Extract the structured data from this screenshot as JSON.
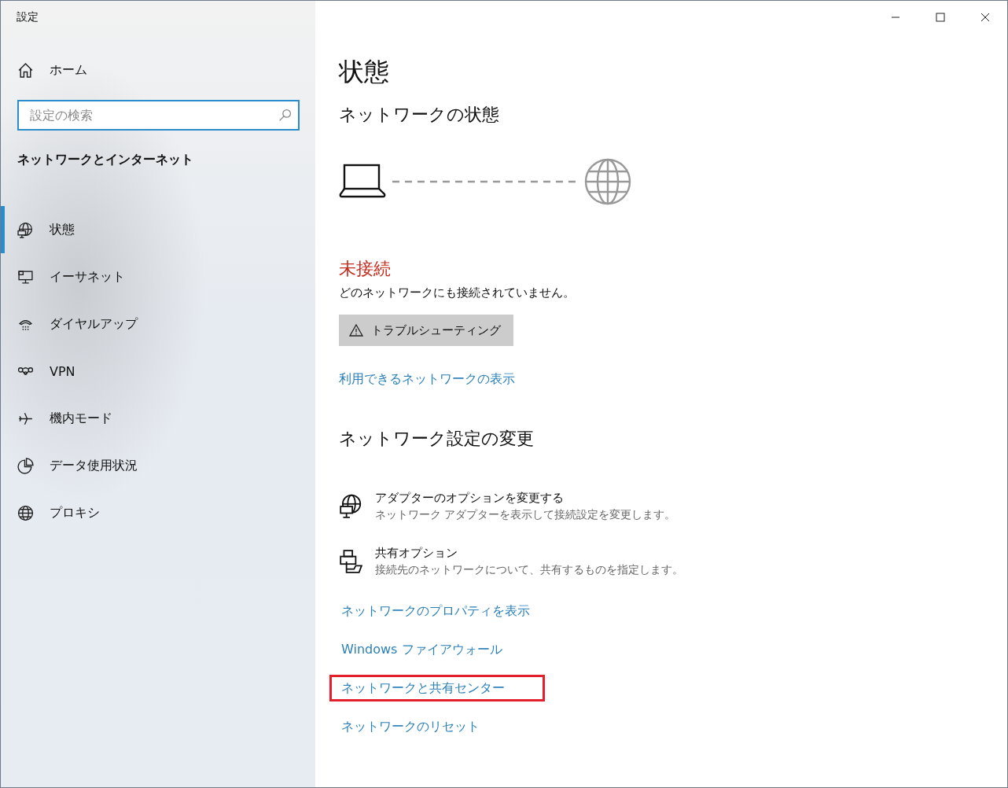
{
  "window": {
    "title": "設定"
  },
  "sidebar": {
    "home": "ホーム",
    "search": {
      "placeholder": "設定の検索"
    },
    "section": "ネットワークとインターネット",
    "items": [
      {
        "label": "状態",
        "selected": true
      },
      {
        "label": "イーサネット",
        "selected": false
      },
      {
        "label": "ダイヤルアップ",
        "selected": false
      },
      {
        "label": "VPN",
        "selected": false
      },
      {
        "label": "機内モード",
        "selected": false
      },
      {
        "label": "データ使用状況",
        "selected": false
      },
      {
        "label": "プロキシ",
        "selected": false
      }
    ]
  },
  "page": {
    "title": "状態",
    "status_heading": "ネットワークの状態",
    "connection": {
      "connected": false,
      "status": "未接続",
      "description": "どのネットワークにも接続されていません。"
    },
    "troubleshoot_button": "トラブルシューティング",
    "available_link": "利用できるネットワークの表示",
    "change_heading": "ネットワーク設定の変更",
    "options": [
      {
        "title": "アダプターのオプションを変更する",
        "description": "ネットワーク アダプターを表示して接続設定を変更します。"
      },
      {
        "title": "共有オプション",
        "description": "接続先のネットワークについて、共有するものを指定します。"
      }
    ],
    "links": [
      {
        "label": "ネットワークのプロパティを表示",
        "highlighted": false
      },
      {
        "label": "Windows ファイアウォール",
        "highlighted": false
      },
      {
        "label": "ネットワークと共有センター",
        "highlighted": true
      },
      {
        "label": "ネットワークのリセット",
        "highlighted": false
      }
    ]
  }
}
